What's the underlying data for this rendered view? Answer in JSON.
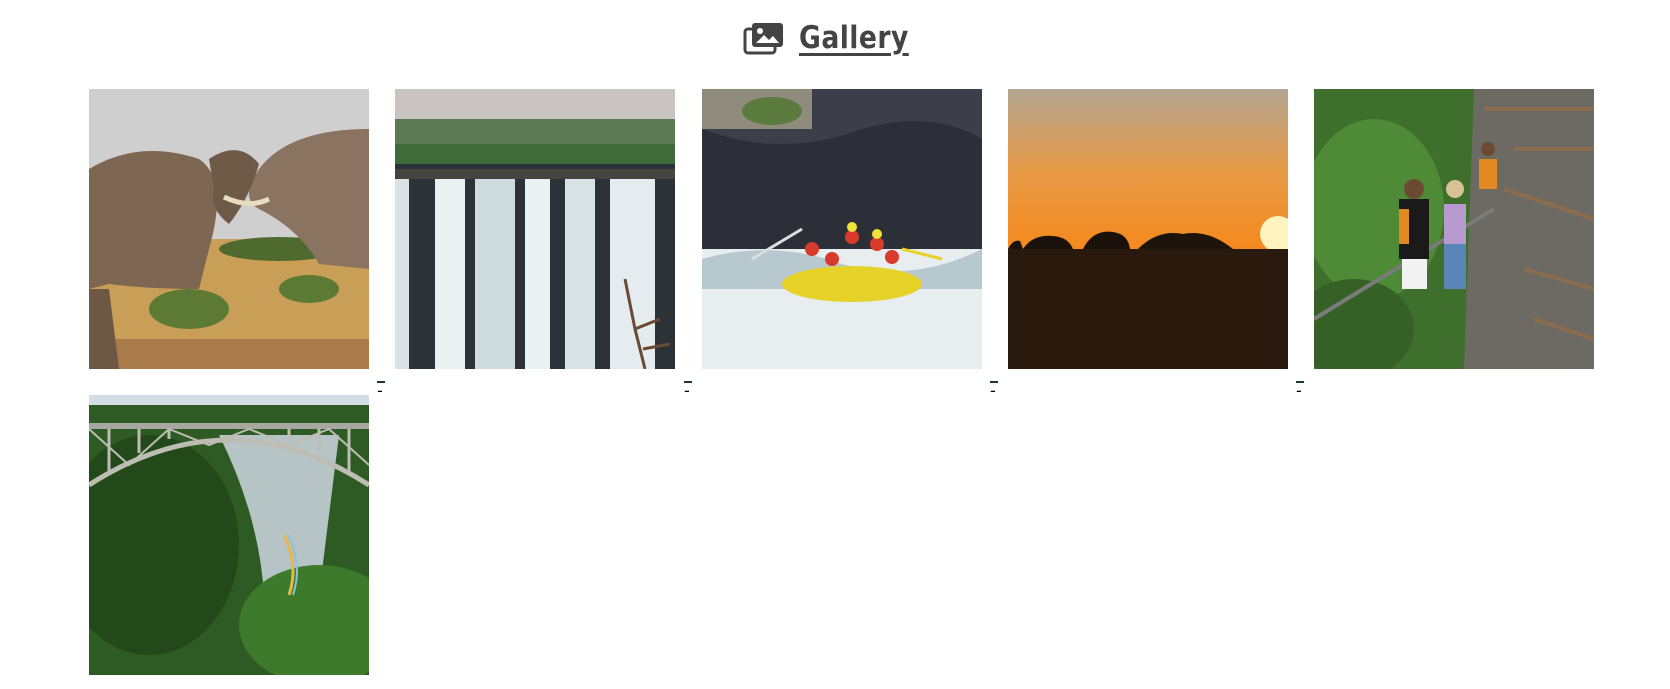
{
  "header": {
    "title": "Gallery",
    "icon": "photo-gallery-icon",
    "color": "#444444"
  },
  "photos": [
    {
      "subject": "elephants-icon"
    },
    {
      "subject": "waterfall-icon"
    },
    {
      "subject": "river-rafting-icon"
    },
    {
      "subject": "sunset-elephants-icon"
    },
    {
      "subject": "bridge-walkway-icon"
    },
    {
      "subject": "bridge-gorge-rainbow-icon"
    }
  ],
  "separators": [
    "-",
    "-",
    "-",
    "-"
  ]
}
